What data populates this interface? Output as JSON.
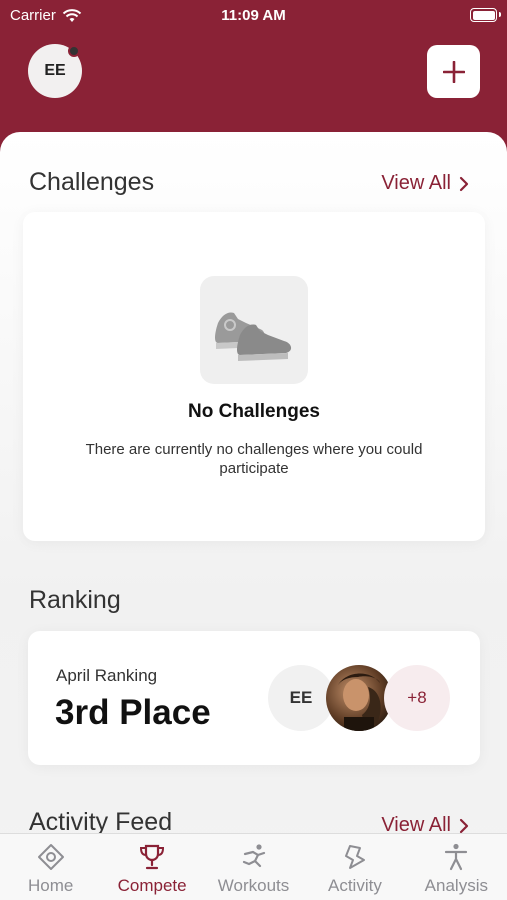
{
  "status": {
    "carrier": "Carrier",
    "time": "11:09 AM"
  },
  "header": {
    "avatar_initials": "EE"
  },
  "challenges": {
    "title": "Challenges",
    "view_all": "View All",
    "empty_title": "No Challenges",
    "empty_desc": "There are currently no challenges where you could participate"
  },
  "ranking": {
    "title": "Ranking",
    "label": "April Ranking",
    "value": "3rd Place",
    "avatar_initials": "EE",
    "more_count": "+8"
  },
  "activity_feed": {
    "title": "Activity Feed",
    "view_all": "View All"
  },
  "tabs": [
    {
      "label": "Home",
      "icon": "home-icon"
    },
    {
      "label": "Compete",
      "icon": "trophy-icon",
      "active": true
    },
    {
      "label": "Workouts",
      "icon": "workouts-icon"
    },
    {
      "label": "Activity",
      "icon": "activity-icon"
    },
    {
      "label": "Analysis",
      "icon": "analysis-icon"
    }
  ],
  "colors": {
    "accent": "#8a2236",
    "background": "#f3f3f3",
    "inactive_tab": "#8e8e93"
  }
}
